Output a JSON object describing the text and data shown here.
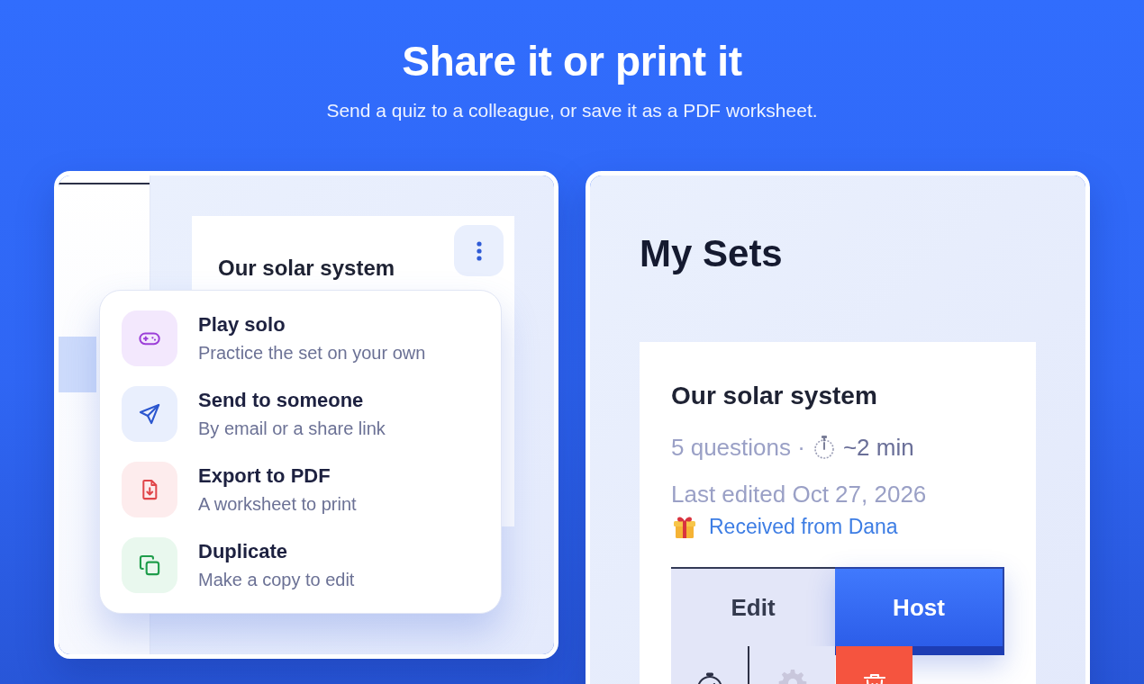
{
  "header": {
    "title": "Share it or print it",
    "subtitle": "Send a quiz to a colleague, or save it as a PDF worksheet."
  },
  "share_panel": {
    "set_card": {
      "title": "Our solar system"
    },
    "menu": {
      "items": [
        {
          "kind": "play",
          "title": "Play solo",
          "description": "Practice the set on your own"
        },
        {
          "kind": "send",
          "title": "Send to someone",
          "description": "By email or a share link"
        },
        {
          "kind": "pdf",
          "title": "Export to PDF",
          "description": "A worksheet to print"
        },
        {
          "kind": "duplicate",
          "title": "Duplicate",
          "description": "Make a copy to edit"
        }
      ]
    }
  },
  "sets_panel": {
    "heading": "My Sets",
    "set_card": {
      "title": "Our solar system",
      "question_count": "5 questions ·",
      "duration": "~2 min",
      "last_edited": "Last edited Oct 27, 2026",
      "received_from": "Received from Dana",
      "buttons": [
        {
          "kind": "edit",
          "label": "Edit"
        },
        {
          "kind": "host",
          "label": "Host"
        }
      ]
    }
  }
}
